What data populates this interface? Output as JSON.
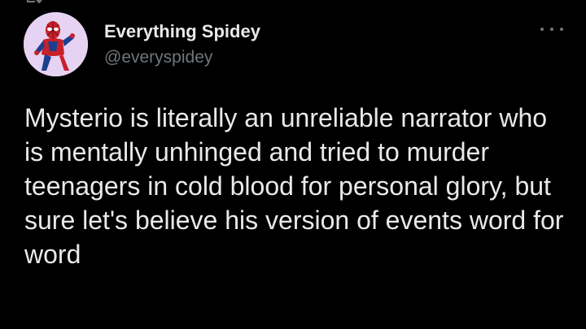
{
  "colors": {
    "background": "#000000",
    "text_primary": "#e7e9ea",
    "text_secondary": "#71767b",
    "avatar_bg": "#e6d2f2"
  },
  "retweet_bar": {
    "icon": "retweet-icon"
  },
  "tweet": {
    "avatar_icon": "spiderman-avatar-icon",
    "display_name": "Everything Spidey",
    "handle": "@everyspidey",
    "more_icon": "more-options-icon",
    "text": "Mysterio is literally an unreliable narrator who is mentally unhinged and tried to murder teenagers in cold blood for personal glory, but sure let's believe his version of events word for word"
  }
}
